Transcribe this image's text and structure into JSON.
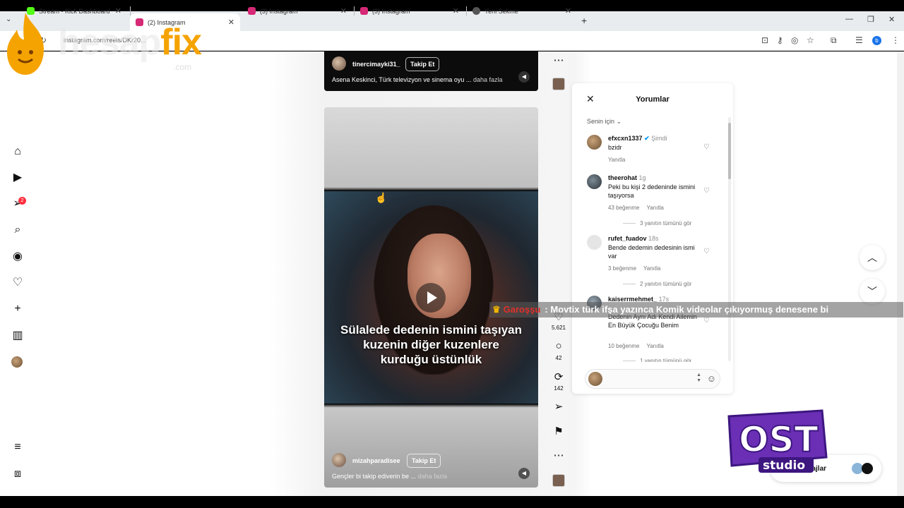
{
  "browser": {
    "tabs": [
      {
        "title": "Stream - Kick Dashboard",
        "favicon_color": "#53fc18",
        "active": false
      },
      {
        "title": "(2) Instagram",
        "favicon_color": "#d62976",
        "active": true
      },
      {
        "title": "(3) Instagram",
        "favicon_color": "#d62976",
        "active": false
      },
      {
        "title": "(3) Instagram",
        "favicon_color": "#d62976",
        "active": false
      },
      {
        "title": "Yeni Sekme",
        "favicon_color": "#555555",
        "active": false
      }
    ],
    "url": "instagram.com/reels/DKr20...",
    "profile_initial": "b"
  },
  "nav": {
    "items": [
      "home-icon",
      "reels-icon",
      "direct-icon",
      "search-icon",
      "explore-icon",
      "heart-icon",
      "create-icon",
      "dashboard-icon"
    ],
    "notification_count": "2"
  },
  "reel_top": {
    "username": "tinercimayki31_",
    "follow_label": "Takip Et",
    "description": "Asena Keskinci, Türk televizyon ve sinema oyu ...",
    "more_label": "daha fazla"
  },
  "reel_main": {
    "caption": "Sülalede dedenin ismini taşıyan kuzenin diğer kuzenlere kurduğu üstünlük",
    "username": "mizahparadisee",
    "follow_label": "Takip Et",
    "description": "Gençler bi takip ediverin be ...",
    "more_label": "daha fazla"
  },
  "actions": {
    "likes": "5.621",
    "comments": "42",
    "reposts": "142"
  },
  "comments_panel": {
    "title": "Yorumlar",
    "filter_label": "Senin için",
    "comments": [
      {
        "user": "efxcxn1337",
        "time": "Şimdi",
        "text": "bzidr",
        "likes": "",
        "reply_label": "Yanıtla",
        "replies": ""
      },
      {
        "user": "theerohat",
        "time": "1g",
        "text": "Peki bu kişi 2 dedeninde ismini taşıyorsa",
        "likes": "43 beğenme",
        "reply_label": "Yanıtla",
        "replies": "3 yanıtın tümünü gör"
      },
      {
        "user": "rufet_fuadov",
        "time": "18s",
        "text": "Bende dedemin dedesinin ismi var",
        "likes": "3 beğenme",
        "reply_label": "Yanıtla",
        "replies": "2 yanıtın tümünü gör"
      },
      {
        "user": "kaiserrmehmet_",
        "time": "17s",
        "text": "Dedenin Aynı Adı Kendi Ailemin En Büyük Çocuğu Benim",
        "likes": "10 beğenme",
        "reply_label": "Yanıtla",
        "replies": "1 yanıtın tümünü gör"
      }
    ]
  },
  "overlay": {
    "ticker_user": "Garoşşu",
    "ticker_message": ": Movtix türk ifşa yazınca Komik videolar çıkıyormuş denesene bi",
    "watermark_left": "hesap",
    "watermark_right": "fix",
    "watermark_suffix": ".com",
    "logo_text": "OST",
    "logo_subtext": "studio",
    "msg_label": "Mesajlar"
  }
}
